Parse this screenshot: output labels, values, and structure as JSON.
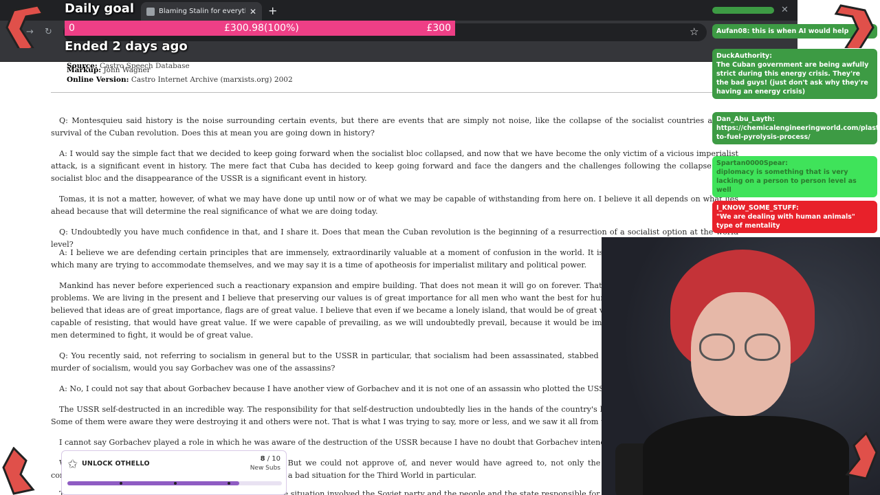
{
  "browser": {
    "tab_title": "Blaming Stalin for everything w",
    "tab_close": "✕",
    "new_tab": "+",
    "window_close": "✕"
  },
  "goal": {
    "title": "Daily goal",
    "min": "0",
    "current": "£300.98(100%)",
    "max": "£300",
    "progress": 1.0,
    "ended": "Ended 2 days ago",
    "color": "#ee3f86"
  },
  "meta": {
    "source_label": "Source:",
    "source_value": "Castro Speech Database",
    "markup_label": "Markup:",
    "markup_value": "John Wagner",
    "online_label": "Online Version:",
    "online_value": "Castro Internet Archive (marxists.org) 2002"
  },
  "paragraphs": [
    "Q: Montesquieu said history is the noise surrounding certain events, but there are events that are simply not noise, like the collapse of the socialist countries and the survival of the Cuban revolution. Does this at mean you are going down in history?",
    "A: I would say the simple fact that we decided to keep going forward when the socialist bloc collapsed, and now that we have become the only victim of a vicious imperialist attack, is a significant event in history. The mere fact that Cuba has decided to keep going forward and face the dangers and the challenges following the collapse of the socialist bloc and the disappearance of the USSR is a significant event in history.",
    "Tomas, it is not a matter, however, of what we may have done up until now or of what we may be capable of withstanding from here on. I believe it all depends on what lies ahead because that will determine the real significance of what we are doing today.",
    "Q: Undoubtedly you have much confidence in that, and I share it. Does that mean the Cuban revolution is the beginning of a resurrection of a socialist option at the world level?",
    "A: I believe we are defending certain principles that are immensely, extraordinarily valuable at a moment of confusion in the world. It is a time for opportunists, a time in which many are trying to accommodate themselves, and we may say it is a time of apotheosis for imperialist military and political power.",
    "Mankind has never before experienced such a reactionary expansion and empire building. That does not mean it will go on forever. That empire is corroded by all types of problems. We are living in the present and I believe that preserving our values is of great importance for all men who want the best for humanity. I believe and I have always believed that ideas are of great importance, flags are of great value. I believe that even if we became a lonely island, that would be of great value. If we were invaded and were capable of resisting, that would have great value. If we were capable of prevailing, as we will undoubtedly prevail, because it would be impossible to exterminate millions of men determined to fight, it would be of great value.",
    "Q: You recently said, not referring to socialism in general but to the USSR in particular, that socialism had been assassinated, stabbed in the back. In this context, in the murder of socialism, would you say Gorbachev was one of the assassins?",
    "A: No, I could not say that about Gorbachev because I have another view of Gorbachev and it is not one of an assassin who plotted the USSR's destruction.",
    "The USSR self-destructed in an incredible way. The responsibility for that self-destruction undoubtedly lies in the hands of the country's leaders, those who led the country. Some of them were aware they were destroying it and others were not. That is what I was trying to say, more or less, and we saw it all from the beginning.",
    "I cannot say Gorbachev played a role in which he was aware of the destruction of the USSR because I have no doubt that Gorbachev intended to fight to improve socialism.",
    "We sympathized with the efforts to improve the USSR. But we could not approve of, and never would have agreed to, not only the destruction of the USSR and the consequences it had on all peoples of the world and created a bad situation for the Third World in particular.",
    "Then came the decision to dissolve it, when practically the situation involved the Soviet party and the people and the state responsible for the state."
  ],
  "chat": [
    {
      "user": "Aufan08:",
      "text": "this is when AI would help",
      "style": "green"
    },
    {
      "user": "DuckAuthority:",
      "text": "The Cuban government are being awfully strict during this energy crisis. They're the bad guys! (just don't ask why they're having an energy crisis)",
      "style": "green"
    },
    {
      "user": "Dan_Abu_Layth:",
      "text": "https://chemicalengineeringworld.com/plastic-to-fuel-pyrolysis-process/",
      "style": "green"
    },
    {
      "user": "Spartan0000Spear:",
      "text": "diplomacy is something that is very lacking on a person to person level as well",
      "style": "lime"
    },
    {
      "user": "I_KNOW_SOME_STUFF:",
      "text": "\"We are dealing with human animals\" type of mentality",
      "style": "red"
    }
  ],
  "unlock": {
    "label": "UNLOCK OTHELLO",
    "current": "8",
    "separator": " / ",
    "total": "10",
    "sub": "New Subs",
    "progress": 0.8,
    "color": "#8f5cc3"
  },
  "icons": {
    "star": "☆",
    "unlock_star": "✩",
    "reload": "↻",
    "forward": "→"
  }
}
